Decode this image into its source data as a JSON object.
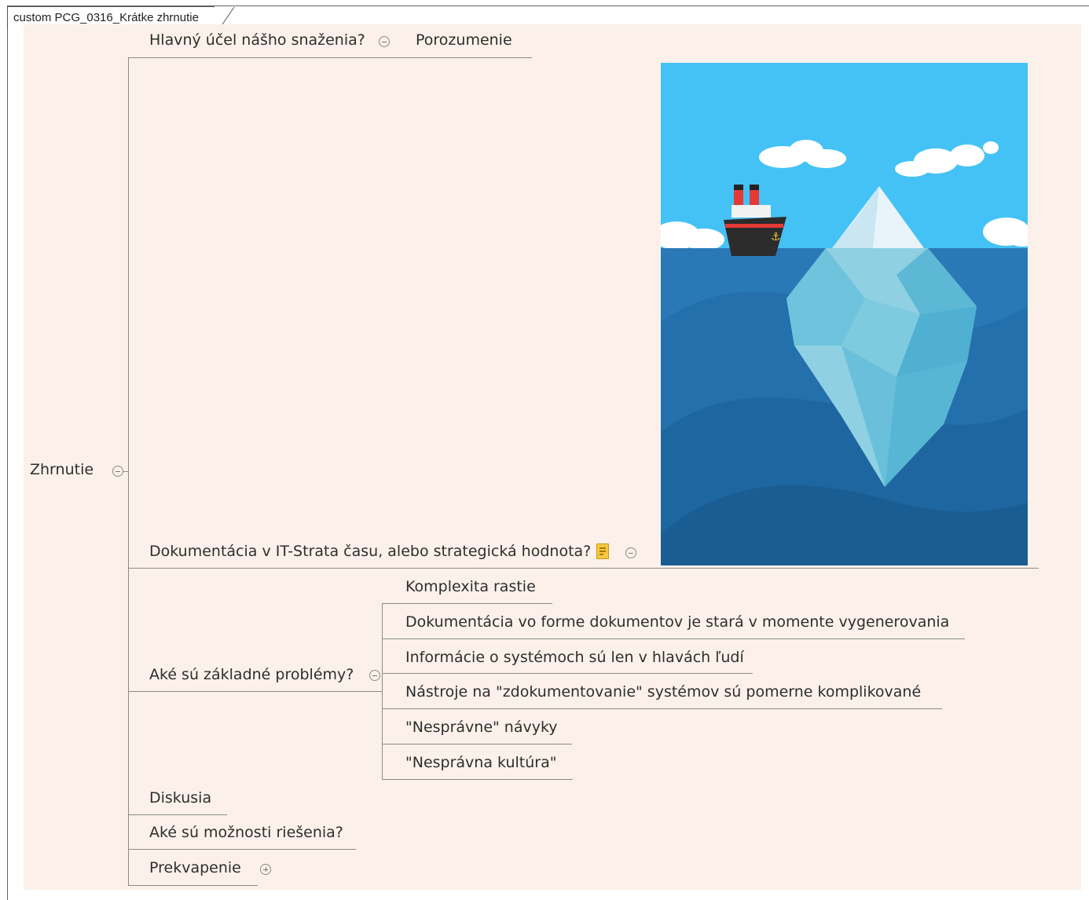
{
  "sheet_tab": {
    "label": "custom PCG_0316_Krátke zhrnutie"
  },
  "root": {
    "label": "Zhrnutie"
  },
  "topics": [
    {
      "label": "Hlavný účel nášho snaženia?",
      "children": [
        "Porozumenie"
      ]
    },
    {
      "label": "Dokumentácia v IT-Strata času, alebo strategická hodnota?",
      "has_note": true,
      "image": "iceberg-illustration"
    },
    {
      "label": "Aké sú základné problémy?",
      "children": [
        "Komplexita rastie",
        "Dokumentácia vo forme dokumentov je stará v momente vygenerovania",
        "Informácie o systémoch sú len v hlavách ľudí",
        "Nástroje na \"zdokumentovanie\" systémov sú pomerne komplikované",
        "\"Nesprávne\" návyky",
        "\"Nesprávna kultúra\""
      ]
    },
    {
      "label": "Diskusia"
    },
    {
      "label": "Aké sú možnosti riešenia?"
    },
    {
      "label": "Prekvapenie",
      "collapsed": true
    }
  ],
  "colors": {
    "canvas_bg": "#fbf1ea",
    "sky": "#45c2f5",
    "sea": "#1b6aa5",
    "connector": "#8a8a8a"
  }
}
